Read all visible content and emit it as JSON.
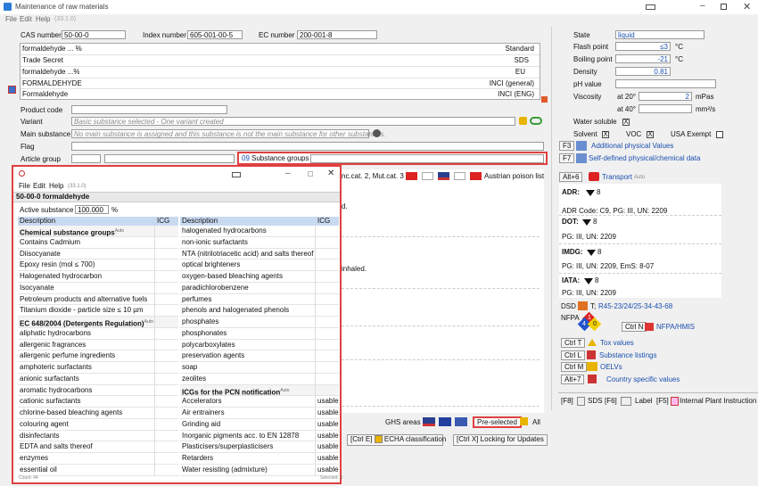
{
  "main_window": {
    "title": "Maintenance of raw materials",
    "menu": [
      "File",
      "Edit",
      "Help",
      "(33.1.0)"
    ],
    "labels": {
      "cas": "CAS number",
      "index": "Index number",
      "ec": "EC number",
      "product_code": "Product code",
      "variant": "Variant",
      "main_substance": "Main substance",
      "flag": "Flag",
      "article_group": "Article group",
      "substance_groups": "Substance groups",
      "substance_groups_count": "09"
    },
    "values": {
      "cas": "50-00-0",
      "index": "605-001-00-5",
      "ec": "200-001-8",
      "variant": "Basic substance selected - One variant created",
      "main_substance": "No main substance is assigned and this substance is not the main substance for other substances."
    },
    "names": [
      {
        "name": "formaldehyde ... %",
        "tag": "Standard"
      },
      {
        "name": "Trade Secret",
        "tag": "SDS"
      },
      {
        "name": "formaldehyde ...%",
        "tag": "EU"
      },
      {
        "name": "FORMALDEHYDE",
        "tag": "INCI (general)"
      },
      {
        "name": "Formaldehyde",
        "tag": "INCI (ENG)"
      }
    ],
    "classification_strip": "nc.cat. 2, Mut.cat. 3",
    "austrian": "Austrian poison list",
    "fragment_d": "d.",
    "fragment_inhaled": "inhaled.",
    "ghs_areas": "GHS areas",
    "preselected": "Pre-selected",
    "all": "All",
    "echa_btn": "[Ctrl E]",
    "echa_label": "ECHA classification",
    "locking_btn": "[Ctrl X] Locking for Updates"
  },
  "physical": {
    "state_label": "State",
    "state_value": "liquid",
    "flash_label": "Flash point",
    "flash_value": "≤3",
    "flash_unit": "°C",
    "boil_label": "Boiling point",
    "boil_value": "-21",
    "boil_unit": "°C",
    "density_label": "Density",
    "density_value": "0.81",
    "ph_label": "pH value",
    "visc_label": "Viscosity",
    "visc_at20": "at 20°",
    "visc_at20_value": "2",
    "visc_at20_unit": "mPas",
    "visc_at40": "at 40°",
    "visc_at40_unit": "mm²/s",
    "water_label": "Water soluble",
    "water_checked": "X",
    "solvent_label": "Solvent",
    "solvent_checked": "X",
    "voc_label": "VOC",
    "voc_checked": "X",
    "usa_label": "USA Exempt"
  },
  "side_links": {
    "f3_key": "F3",
    "f3_label": "Additional physical Values",
    "f7_key": "F7",
    "f7_label": "Self-defined physical/chemical data",
    "alt6_key": "Alt+6",
    "transport_label": "Transport",
    "transport_auto": "Auto"
  },
  "transport": [
    {
      "mode": "ADR:",
      "num": "8",
      "detail": "ADR Code: C9, PG: III, UN: 2209"
    },
    {
      "mode": "DOT:",
      "num": "8",
      "detail": "PG: III, UN: 2209"
    },
    {
      "mode": "IMDG:",
      "num": "8",
      "detail": "PG: III, UN: 2209, EmS: 8-07"
    },
    {
      "mode": "IATA:",
      "num": "8",
      "detail": "PG: III, UN: 2209"
    }
  ],
  "dsd": {
    "label": "DSD",
    "prefix": "T;",
    "value": "R45-23/24/25-34-43-68"
  },
  "nfpa": {
    "label": "NFPA",
    "health": "4",
    "fire": "1",
    "reactivity": "0",
    "ctrl_n": "Ctrl N",
    "nfpa_hmis": "NFPA/HMIS"
  },
  "bottom_links": [
    {
      "key": "Ctrl T",
      "label": "Tox values"
    },
    {
      "key": "Ctrl L",
      "label": "Substance listings"
    },
    {
      "key": "Ctrl M",
      "label": "OELVs"
    },
    {
      "key": "Alt+7",
      "label": "Country specific values"
    }
  ],
  "tabs": [
    {
      "key": "[F8]",
      "label": "SDS"
    },
    {
      "key": "[F6]",
      "label": "Label"
    },
    {
      "key": "[F5]",
      "label": "Internal Plant Instruction"
    }
  ],
  "popup": {
    "menu": [
      "File",
      "Edit",
      "Help",
      "(33.1.0)"
    ],
    "header": "50-00-0 formaldehyde",
    "active_label": "Active substance",
    "active_value": "100.000",
    "active_unit": "%",
    "col_desc": "Description",
    "col_icg": "ICG",
    "left_rows": [
      {
        "text": "Chemical substance groups",
        "bold": true,
        "auto": "Auto"
      },
      {
        "text": "Contains Cadmium"
      },
      {
        "text": "Diisocyanate"
      },
      {
        "text": "Epoxy resin (mol ≤ 700)"
      },
      {
        "text": "Halogenated hydrocarbon"
      },
      {
        "text": "Isocyanate"
      },
      {
        "text": "Petroleum products and alternative fuels"
      },
      {
        "text": "Titanium dioxide - particle size ≤ 10 µm"
      },
      {
        "text": "EC 648/2004 (Detergents Regulation)",
        "bold": true,
        "auto": "Auto"
      },
      {
        "text": "aliphatic hydrocarbons"
      },
      {
        "text": "allergenic fragrances"
      },
      {
        "text": "allergenic perfume ingredients"
      },
      {
        "text": "amphoteric surfactants"
      },
      {
        "text": "anionic surfactants"
      },
      {
        "text": "aromatic hydrocarbons"
      },
      {
        "text": "cationic surfactants"
      },
      {
        "text": "chlorine-based bleaching agents"
      },
      {
        "text": "colouring agent"
      },
      {
        "text": "disinfectants"
      },
      {
        "text": "EDTA and salts thereof"
      },
      {
        "text": "enzymes"
      },
      {
        "text": "essential oil"
      }
    ],
    "right_rows": [
      {
        "text": "halogenated hydrocarbons",
        "icg": ""
      },
      {
        "text": "non-ionic surfactants",
        "icg": ""
      },
      {
        "text": "NTA (nitrilotriacetic acid) and salts thereof",
        "icg": ""
      },
      {
        "text": "optical brighteners",
        "icg": ""
      },
      {
        "text": "oxygen-based bleaching agents",
        "icg": ""
      },
      {
        "text": "paradichlorobenzene",
        "icg": ""
      },
      {
        "text": "perfumes",
        "icg": ""
      },
      {
        "text": "phenols and halogenated phenols",
        "icg": ""
      },
      {
        "text": "phosphates",
        "icg": ""
      },
      {
        "text": "phosphonates",
        "icg": ""
      },
      {
        "text": "polycarboxylates",
        "icg": ""
      },
      {
        "text": "preservation agents",
        "icg": ""
      },
      {
        "text": "soap",
        "icg": ""
      },
      {
        "text": "zeolites",
        "icg": ""
      },
      {
        "text": "ICGs for the PCN notification",
        "bold": true,
        "auto": "Auto",
        "icg": ""
      },
      {
        "text": "Accelerators",
        "icg": "usable"
      },
      {
        "text": "Air entrainers",
        "icg": "usable"
      },
      {
        "text": "Grinding aid",
        "icg": "usable"
      },
      {
        "text": "Inorganic pigments acc. to EN 12878",
        "icg": "usable"
      },
      {
        "text": "Plasticisers/superplasticisers",
        "icg": "usable"
      },
      {
        "text": "Retarders",
        "icg": "usable"
      },
      {
        "text": "Water resisting (admixture)",
        "icg": "usable"
      }
    ],
    "status_left": "Count: 44",
    "status_right": "Selected: 0"
  },
  "colors": {
    "accent_red": "#e04040",
    "link_blue": "#1a4fb0",
    "header_blue": "#c8daf0"
  }
}
